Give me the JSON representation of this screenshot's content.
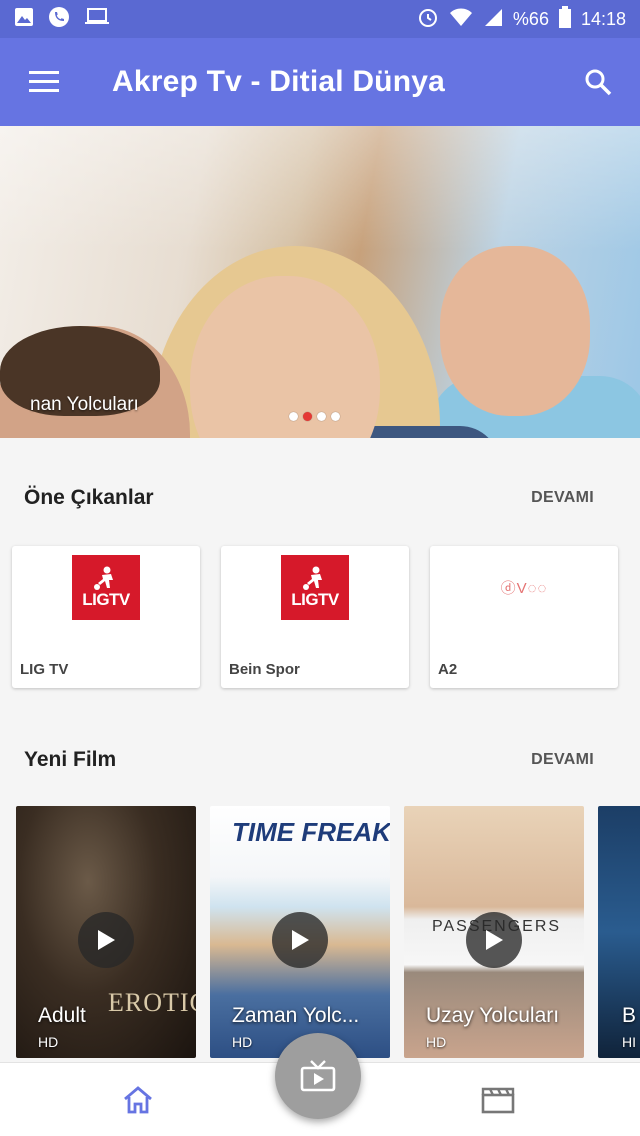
{
  "status_bar": {
    "battery_percent": "%66",
    "time": "14:18",
    "icons_left": [
      "image-icon",
      "phone-icon",
      "laptop-icon"
    ],
    "icons_right": [
      "alarm-icon",
      "wifi-icon",
      "signal-icon",
      "battery-icon"
    ]
  },
  "app_bar": {
    "title": "Akrep Tv - Ditial Dünya",
    "color": "#6674e2"
  },
  "hero": {
    "caption": "nan Yolcuları",
    "slide_count": 4,
    "active_slide": 2
  },
  "featured": {
    "title": "Öne Çıkanlar",
    "more_label": "DEVAMI",
    "channels": [
      {
        "name": "LIG TV",
        "logo": "ligtv-logo",
        "logo_text": "LIGTV"
      },
      {
        "name": "Bein Spor",
        "logo": "ligtv-logo",
        "logo_text": "LIGTV"
      },
      {
        "name": "A2",
        "logo": "dv-logo",
        "logo_text": "ⓓV◌◌"
      }
    ]
  },
  "new_movies": {
    "title": "Yeni Film",
    "more_label": "DEVAMI",
    "items": [
      {
        "title": "Adult",
        "quality": "HD",
        "poster_text": "EROTIC"
      },
      {
        "title": "Zaman Yolc...",
        "quality": "HD",
        "poster_text": "TIME FREAK"
      },
      {
        "title": "Uzay Yolcuları",
        "quality": "HD",
        "poster_text": "PASSENGERS"
      },
      {
        "title": "B",
        "quality": "HI"
      }
    ]
  },
  "bottom_nav": {
    "items": [
      "home-icon",
      "live-tv-icon",
      "movies-icon"
    ],
    "active_color": "#6674e2"
  }
}
